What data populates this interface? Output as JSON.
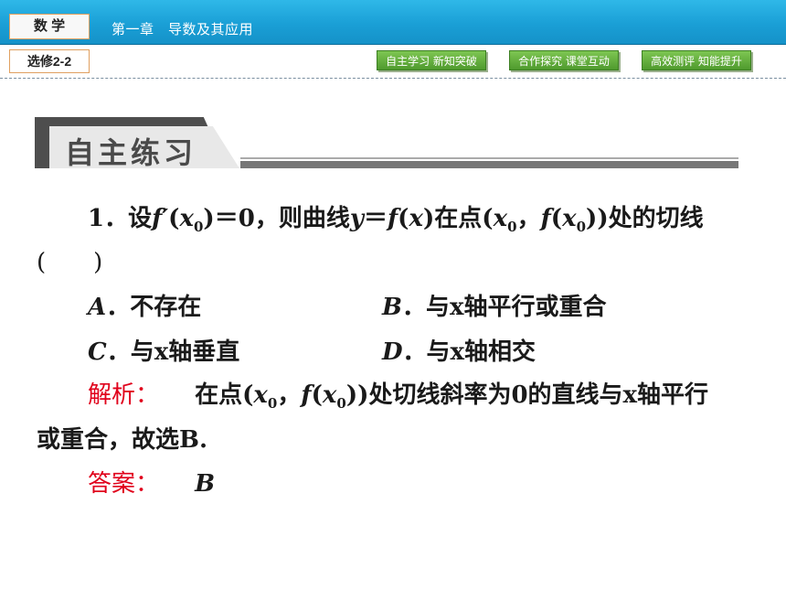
{
  "header": {
    "subject": "数 学",
    "elective": "选修2-2",
    "chapter": "第一章　导数及其应用",
    "nav": [
      {
        "label": "自主学习 新知突破"
      },
      {
        "label": "合作探究 课堂互动"
      },
      {
        "label": "高效测评 知能提升"
      }
    ]
  },
  "section": {
    "title": "自主练习"
  },
  "question": {
    "number": "1．",
    "stem_a": "设",
    "stem_b": "＝0，则曲线",
    "stem_c": "在点",
    "stem_d": "处的切线",
    "paren": "(　　)",
    "options": {
      "A": {
        "letter": "A",
        "text": "．不存在"
      },
      "B": {
        "letter": "B",
        "text": "．与x轴平行或重合"
      },
      "C": {
        "letter": "C",
        "text": "．与x轴垂直"
      },
      "D": {
        "letter": "D",
        "text": "．与x轴相交"
      }
    },
    "analysis_label": "解析：",
    "analysis_a": "在点",
    "analysis_b": "处切线斜率为0的直线与x轴平行",
    "analysis_c": "或重合，故选B.",
    "answer_label": "答案：",
    "answer": "B"
  },
  "colors": {
    "accent": "#1a9fd6",
    "nav_green": "#5aa635",
    "label_red": "#e0001b"
  }
}
